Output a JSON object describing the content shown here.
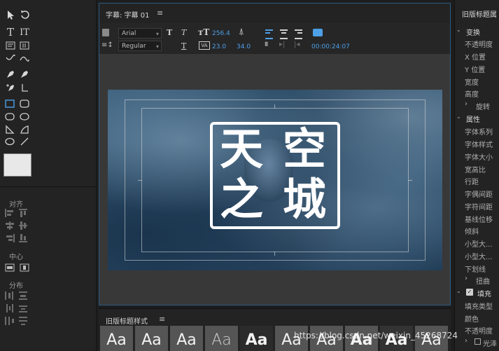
{
  "title_panel": {
    "tab_label": "字幕: 字幕 01",
    "menu_icon": "≡",
    "font_family": "Arial",
    "font_style": "Regular",
    "font_size": "256.4",
    "leading": "23.0",
    "kerning": "34.0",
    "timecode": "00:00:24:07"
  },
  "canvas": {
    "line1_char1": "天",
    "line1_char2": "空",
    "line2_char1": "之",
    "line2_char2": "城"
  },
  "left_panel": {
    "align_label": "对齐",
    "center_label": "中心",
    "distribute_label": "分布"
  },
  "styles_panel": {
    "title": "旧版标题样式",
    "menu_icon": "≡",
    "swatch_text": "Aa"
  },
  "properties_panel": {
    "title": "旧版标题属",
    "transform_header": "变换",
    "transform_items": [
      "不透明度",
      "X 位置",
      "Y 位置",
      "宽度",
      "高度"
    ],
    "rotation": "旋转",
    "properties_header": "属性",
    "property_items": [
      "字体系列",
      "字体样式",
      "字体大小",
      "宽高比",
      "行距",
      "字偶间距",
      "字符间距",
      "基线位移",
      "倾斜",
      "小型大...",
      "小型大...",
      "下划线"
    ],
    "distort": "扭曲",
    "fill_header": "填充",
    "fill_items": [
      "填充类型",
      "颜色",
      "不透明度"
    ],
    "gloss": "光泽"
  },
  "watermark": "https://blog.csdn.net/weixin_45268724",
  "colors": {
    "accent_blue": "#4d9fe6",
    "panel_border": "#2b5b84"
  }
}
